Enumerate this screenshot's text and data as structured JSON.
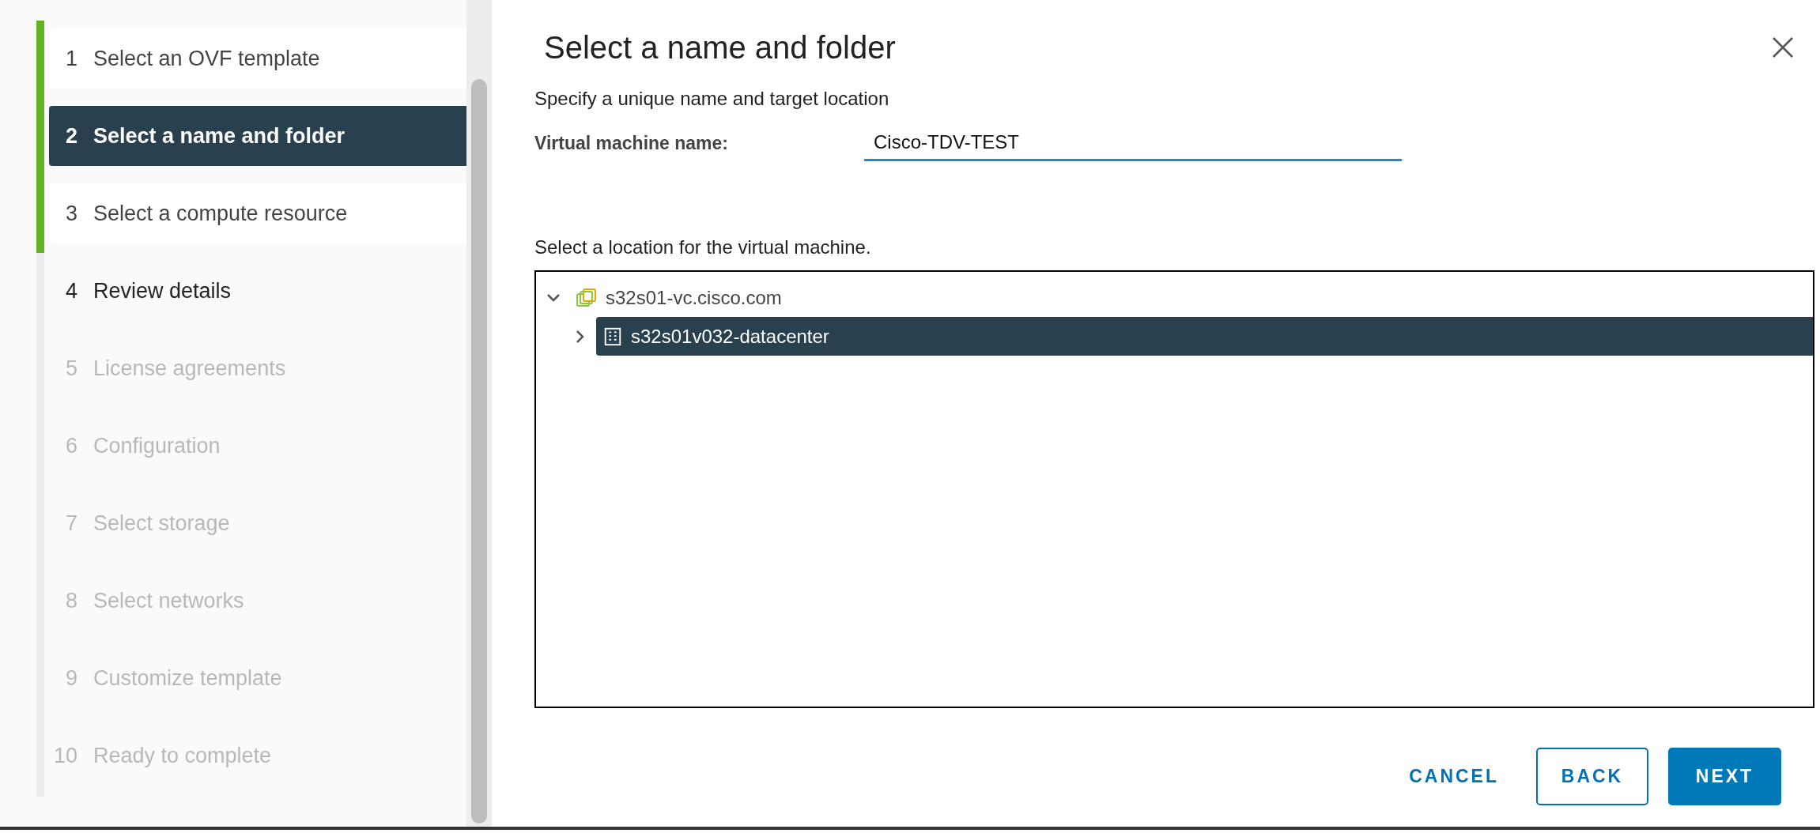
{
  "steps": [
    {
      "number": "1",
      "label": "Select an OVF template",
      "completed": true,
      "selected": false,
      "disabled": false
    },
    {
      "number": "2",
      "label": "Select a name and folder",
      "completed": true,
      "selected": true,
      "disabled": false
    },
    {
      "number": "3",
      "label": "Select a compute resource",
      "completed": true,
      "selected": false,
      "disabled": false
    },
    {
      "number": "4",
      "label": "Review details",
      "completed": false,
      "selected": false,
      "disabled": false
    },
    {
      "number": "5",
      "label": "License agreements",
      "completed": false,
      "selected": false,
      "disabled": true
    },
    {
      "number": "6",
      "label": "Configuration",
      "completed": false,
      "selected": false,
      "disabled": true
    },
    {
      "number": "7",
      "label": "Select storage",
      "completed": false,
      "selected": false,
      "disabled": true
    },
    {
      "number": "8",
      "label": "Select networks",
      "completed": false,
      "selected": false,
      "disabled": true
    },
    {
      "number": "9",
      "label": "Customize template",
      "completed": false,
      "selected": false,
      "disabled": true
    },
    {
      "number": "10",
      "label": "Ready to complete",
      "completed": false,
      "selected": false,
      "disabled": true
    }
  ],
  "dialog": {
    "title": "Select a name and folder",
    "subtitle": "Specify a unique name and target location",
    "name_field": {
      "label": "Virtual machine name:",
      "value": "Cisco-TDV-TEST"
    },
    "location_label": "Select a location for the virtual machine.",
    "tree": [
      {
        "label": "s32s01-vc.cisco.com",
        "kind": "vcenter",
        "expanded": true,
        "selected": false,
        "children": [
          {
            "label": "s32s01v032-datacenter",
            "kind": "datacenter",
            "expanded": false,
            "selected": true
          }
        ]
      }
    ],
    "buttons": [
      {
        "label": "CANCEL",
        "kind": "flat"
      },
      {
        "label": "BACK",
        "kind": "outline"
      },
      {
        "label": "NEXT",
        "kind": "primary"
      }
    ]
  }
}
